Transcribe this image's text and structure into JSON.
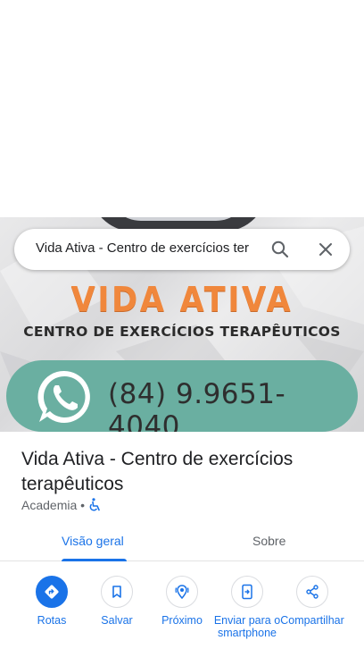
{
  "search": {
    "query": "Vida Ativa - Centro de exercícios ter"
  },
  "hero": {
    "brand_title": "VIDA ATIVA",
    "brand_subtitle": "CENTRO DE EXERCÍCIOS TERAPÊUTICOS",
    "phone": "(84) 9.9651-4040",
    "brand_color": "#f0873c",
    "pill_color": "#6aafa1"
  },
  "place": {
    "name": "Vida Ativa - Centro de exercícios terapêuticos",
    "category": "Academia",
    "separator": "•"
  },
  "tabs": [
    {
      "label": "Visão geral",
      "selected": true
    },
    {
      "label": "Sobre",
      "selected": false
    }
  ],
  "actions": [
    {
      "label": "Rotas",
      "icon": "directions-icon"
    },
    {
      "label": "Salvar",
      "icon": "bookmark-icon"
    },
    {
      "label": "Próximo",
      "icon": "nearby-icon"
    },
    {
      "label": "Enviar para o smartphone",
      "icon": "send-to-phone-icon"
    },
    {
      "label": "Compartilhar",
      "icon": "share-icon"
    }
  ],
  "colors": {
    "accent": "#1a73e8",
    "secondary_text": "#5f6368"
  }
}
